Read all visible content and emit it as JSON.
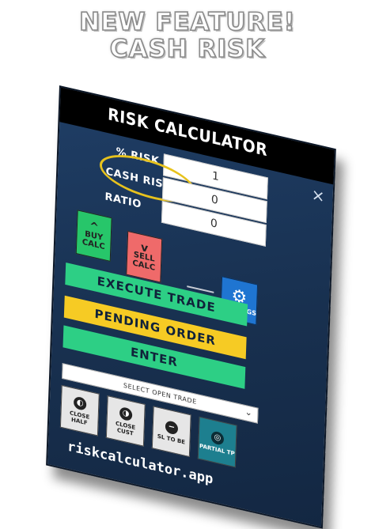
{
  "headline": {
    "line1": "NEW FEATURE!",
    "line2": "CASH RISK"
  },
  "window": {
    "title": "RISK CALCULATOR",
    "close_glyph": "×"
  },
  "fields": [
    {
      "label": "% RISK",
      "value": "1"
    },
    {
      "label": "CASH RISK",
      "value": "0"
    },
    {
      "label": "RATIO",
      "value": "0"
    }
  ],
  "buttons": {
    "buy_line1": "BUY",
    "buy_line2": "CALC",
    "sell_line1": "SELL",
    "sell_line2": "CALC",
    "settings": "SETTINGS",
    "execute": "EXECUTE TRADE",
    "pending": "PENDING ORDER",
    "enter": "ENTER"
  },
  "select": {
    "placeholder": "SELECT OPEN TRADE"
  },
  "actions": [
    "CLOSE HALF",
    "CLOSE CUST",
    "SL TO BE",
    "PARTIAL TP"
  ],
  "site": "riskcalculator.app",
  "colors": {
    "green": "#2dcf85",
    "yellow": "#f6cb24",
    "red": "#ef6a6a",
    "blue": "#1f75d1",
    "panel": "#18304f"
  },
  "icons": [
    "up-arrow-icon",
    "down-arrow-icon",
    "gear-icon",
    "half-circle-icon",
    "target-icon"
  ]
}
